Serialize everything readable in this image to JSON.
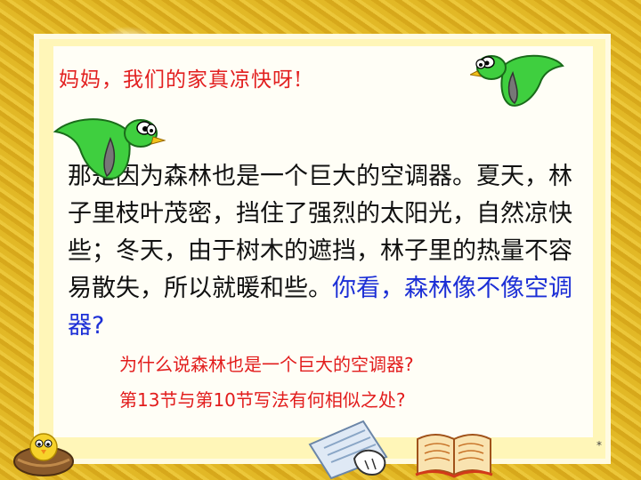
{
  "slide": {
    "title": "妈妈，我们的家真凉快呀!",
    "paragraph_main": "那是因为森林也是一个巨大的空调器。夏天，林子里枝叶茂密，挡住了强烈的太阳光，自然凉快些；冬天，由于树木的遮挡，林子里的热量不容易散失，所以就暖和些。",
    "paragraph_question": "你看，森林像不像空调器?",
    "question_1": "为什么说森林也是一个巨大的空调器?",
    "question_2": "第13节与第10节写法有何相似之处?",
    "page_mark": "*"
  },
  "icons": [
    "green-bird-icon",
    "chick-nest-icon",
    "paper-hand-icon",
    "open-book-icon"
  ],
  "colors": {
    "title_red": "#e22020",
    "question_blue": "#1c2fd6",
    "body_black": "#111111",
    "background_gold": "#deb224"
  }
}
